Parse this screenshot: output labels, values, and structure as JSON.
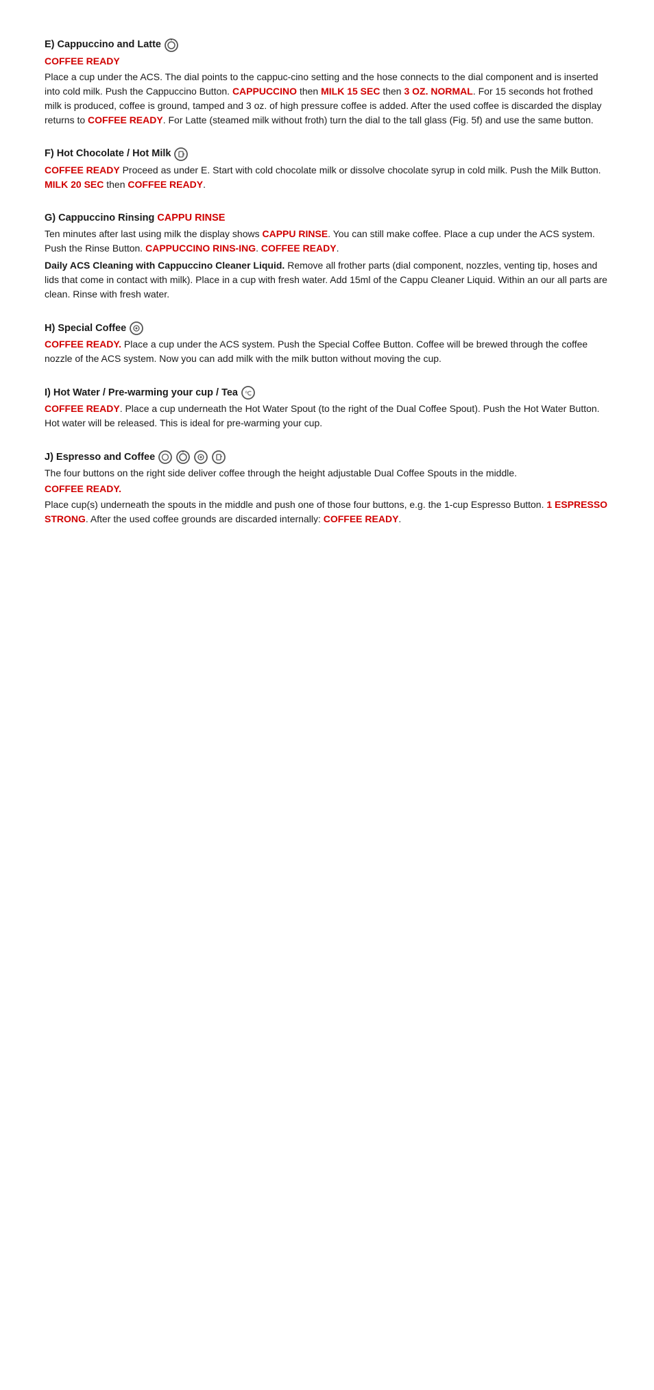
{
  "sections": [
    {
      "id": "E",
      "title_prefix": "E) Cappuccino and Latte",
      "title_icon": "cappuccino-icon",
      "icon_count": 1,
      "status_label": "COFFEE READY",
      "body": [
        {
          "type": "mixed",
          "parts": [
            {
              "text": "Place a cup under the ACS. The dial points to the cappuc-cino setting and the hose connects to the dial component and is inserted into cold milk. Push the Cappuccino Button. ",
              "style": "normal"
            },
            {
              "text": "CAPPUCCINO",
              "style": "red"
            },
            {
              "text": " then ",
              "style": "normal"
            },
            {
              "text": "MILK 15 SEC",
              "style": "red"
            },
            {
              "text": " then ",
              "style": "normal"
            },
            {
              "text": "3 OZ. NORMAL",
              "style": "red"
            },
            {
              "text": ". For 15 seconds hot frothed milk is produced, coffee is ground, tamped and 3 oz. of high pressure coffee is added. After the used coffee is discarded the display returns to ",
              "style": "normal"
            },
            {
              "text": "COFFEE READY",
              "style": "red"
            },
            {
              "text": ". For Latte (steamed milk without froth) turn the dial to the tall glass (Fig. 5f) and use the same button.",
              "style": "normal"
            }
          ]
        }
      ]
    },
    {
      "id": "F",
      "title_prefix": "F) Hot Chocolate / Hot Milk",
      "title_icon": "hot-milk-icon",
      "icon_count": 1,
      "status_label": "COFFEE READY",
      "body": [
        {
          "type": "mixed",
          "parts": [
            {
              "text": "COFFEE READY",
              "style": "red"
            },
            {
              "text": " Proceed as under E. Start with cold chocolate milk or dissolve chocolate syrup in cold milk. Push the Milk Button. ",
              "style": "normal"
            },
            {
              "text": "MILK 20 SEC",
              "style": "red"
            },
            {
              "text": " then ",
              "style": "normal"
            },
            {
              "text": "COFFEE READY",
              "style": "red"
            },
            {
              "text": ".",
              "style": "normal"
            }
          ]
        }
      ]
    },
    {
      "id": "G",
      "title_prefix": "G) Cappuccino Rinsing",
      "title_red": "CAPPU RINSE",
      "title_icon": null,
      "body": [
        {
          "type": "mixed",
          "parts": [
            {
              "text": "Ten minutes after last using milk the display shows ",
              "style": "normal"
            },
            {
              "text": "CAPPU RINSE",
              "style": "red"
            },
            {
              "text": ". You can still make coffee. Place a cup under the ACS system. Push the Rinse Button. ",
              "style": "normal"
            },
            {
              "text": "CAPPUCCINO RINS-ING",
              "style": "red"
            },
            {
              "text": ". ",
              "style": "normal"
            },
            {
              "text": "COFFEE READY",
              "style": "red"
            },
            {
              "text": ".",
              "style": "normal"
            }
          ]
        },
        {
          "type": "mixed",
          "parts": [
            {
              "text": "Daily ACS Cleaning with Cappuccino Cleaner Liquid.",
              "style": "bold"
            },
            {
              "text": " Remove all frother parts (dial component, nozzles, venting tip, hoses and lids that come in contact with milk). Place in a cup with fresh water. Add 15ml of the Cappu Cleaner Liquid. Within an our all parts are clean. Rinse with fresh water.",
              "style": "normal"
            }
          ]
        }
      ]
    },
    {
      "id": "H",
      "title_prefix": "H) Special Coffee",
      "title_icon": "special-coffee-icon",
      "icon_count": 1,
      "body": [
        {
          "type": "mixed",
          "parts": [
            {
              "text": "COFFEE READY.",
              "style": "red"
            },
            {
              "text": " Place a cup under the ACS system. Push the Special Coffee Button. Coffee will be brewed through the coffee nozzle of the ACS system. Now you can add milk with the milk button without moving the cup.",
              "style": "normal"
            }
          ]
        }
      ]
    },
    {
      "id": "I",
      "title_prefix": "I) Hot Water / Pre-warming your cup / Tea",
      "title_icon": "hot-water-icon",
      "icon_count": 1,
      "body": [
        {
          "type": "mixed",
          "parts": [
            {
              "text": "COFFEE READY",
              "style": "red"
            },
            {
              "text": ". Place a cup underneath the Hot Water Spout (to the right of the Dual Coffee Spout). Push the Hot Water Button. Hot water will be released. This is ideal for pre-warming your cup.",
              "style": "normal"
            }
          ]
        }
      ]
    },
    {
      "id": "J",
      "title_prefix": "J) Espresso and Coffee",
      "title_icon": "espresso-icons",
      "icon_count": 4,
      "body": [
        {
          "type": "mixed",
          "parts": [
            {
              "text": "The four buttons on the right side deliver coffee through the height adjustable Dual Coffee Spouts in the middle.",
              "style": "normal"
            }
          ]
        },
        {
          "type": "mixed",
          "parts": [
            {
              "text": "COFFEE READY.",
              "style": "red"
            }
          ]
        },
        {
          "type": "mixed",
          "parts": [
            {
              "text": "Place cup(s) underneath the spouts in the middle and push one of those four buttons, e.g. the 1-cup Espresso Button. ",
              "style": "normal"
            },
            {
              "text": "1 ESPRESSO STRONG",
              "style": "red"
            },
            {
              "text": ". After the used coffee grounds are discarded internally: ",
              "style": "normal"
            },
            {
              "text": "COFFEE READY",
              "style": "red"
            },
            {
              "text": ".",
              "style": "normal"
            }
          ]
        }
      ]
    }
  ],
  "colors": {
    "red": "#d00000",
    "text": "#1a1a1a"
  }
}
